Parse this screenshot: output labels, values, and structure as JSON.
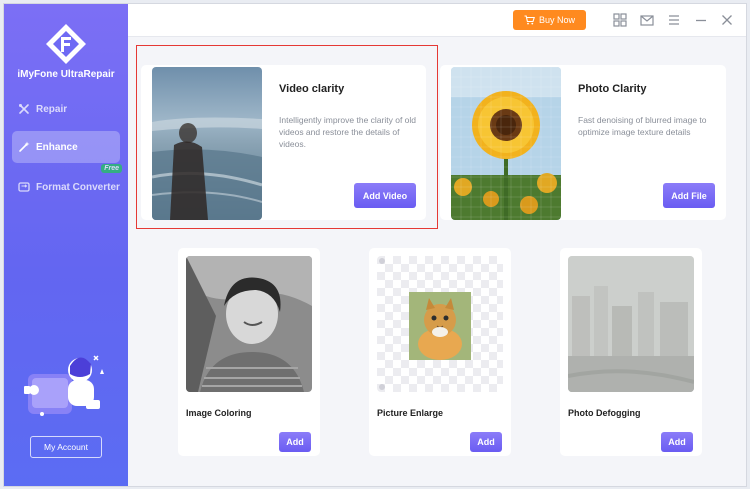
{
  "app": {
    "name": "iMyFone UltraRepair"
  },
  "sidebar": {
    "items": [
      {
        "label": "Repair",
        "icon": "repair-tools-icon",
        "active": false
      },
      {
        "label": "Enhance",
        "icon": "magic-wand-icon",
        "active": true
      },
      {
        "label": "Format Converter",
        "icon": "convert-icon",
        "badge": "Free",
        "active": false
      }
    ],
    "account_label": "My Account"
  },
  "topbar": {
    "buy_label": "Buy Now",
    "icons": [
      "cart-icon",
      "grid-icon",
      "mail-icon",
      "menu-icon",
      "minimize-icon",
      "close-icon"
    ]
  },
  "features": {
    "video": {
      "title": "Video clarity",
      "desc": "Intelligently improve the clarity of old videos and restore the details of videos.",
      "button": "Add Video"
    },
    "photo": {
      "title": "Photo Clarity",
      "desc": "Fast denoising of blurred image to optimize image texture details",
      "button": "Add File"
    },
    "coloring": {
      "title": "Image Coloring",
      "button": "Add"
    },
    "enlarge": {
      "title": "Picture Enlarge",
      "button": "Add"
    },
    "defog": {
      "title": "Photo Defogging",
      "button": "Add"
    }
  },
  "colors": {
    "accent": "#6a5cf2",
    "buy": "#ff8a1f",
    "sidebar": "#6366f1",
    "highlight": "#e53935",
    "badge": "#22c55e"
  }
}
